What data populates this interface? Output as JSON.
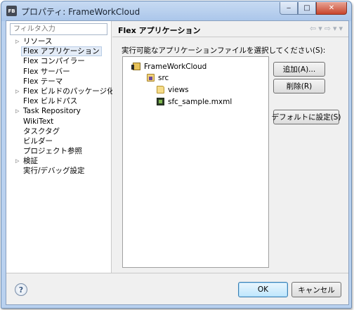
{
  "window": {
    "title": "プロパティ: FrameWorkCloud",
    "app_icon_text": "FB",
    "minimize_glyph": "‒",
    "maximize_glyph": "□",
    "close_glyph": "✕"
  },
  "sidebar": {
    "filter_placeholder": "フィルタ入力",
    "items": [
      {
        "label": "リソース",
        "expandable": true
      },
      {
        "label": "Flex アプリケーション",
        "expandable": false,
        "selected": true
      },
      {
        "label": "Flex コンパイラー",
        "expandable": false
      },
      {
        "label": "Flex サーバー",
        "expandable": false
      },
      {
        "label": "Flex テーマ",
        "expandable": false
      },
      {
        "label": "Flex ビルドのパッケージ化",
        "expandable": true
      },
      {
        "label": "Flex ビルドパス",
        "expandable": false
      },
      {
        "label": "Task Repository",
        "expandable": true
      },
      {
        "label": "WikiText",
        "expandable": false
      },
      {
        "label": "タスクタグ",
        "expandable": false
      },
      {
        "label": "ビルダー",
        "expandable": false
      },
      {
        "label": "プロジェクト参照",
        "expandable": false
      },
      {
        "label": "検証",
        "expandable": true
      },
      {
        "label": "実行/デバッグ設定",
        "expandable": false
      }
    ],
    "expand_glyph": "▷"
  },
  "page": {
    "title": "Flex アプリケーション",
    "back_glyph": "⇦",
    "back_menu_glyph": "▾",
    "forward_glyph": "⇨",
    "forward_menu_glyph": "▾",
    "view_menu_glyph": "▾",
    "instruction": "実行可能なアプリケーションファイルを選択してください(S):",
    "tree": [
      {
        "label": "FrameWorkCloud",
        "icon": "project-icon",
        "depth": 0
      },
      {
        "label": "src",
        "icon": "source-folder-icon",
        "depth": 1
      },
      {
        "label": "views",
        "icon": "folder-icon",
        "depth": 2
      },
      {
        "label": "sfc_sample.mxml",
        "icon": "mxml-file-icon",
        "depth": 2
      }
    ],
    "add_button": "追加(A)...",
    "remove_button": "削除(R)",
    "set_default_button": "デフォルトに設定(S)"
  },
  "footer": {
    "help_glyph": "?",
    "ok_button": "OK",
    "cancel_button": "キャンセル"
  }
}
